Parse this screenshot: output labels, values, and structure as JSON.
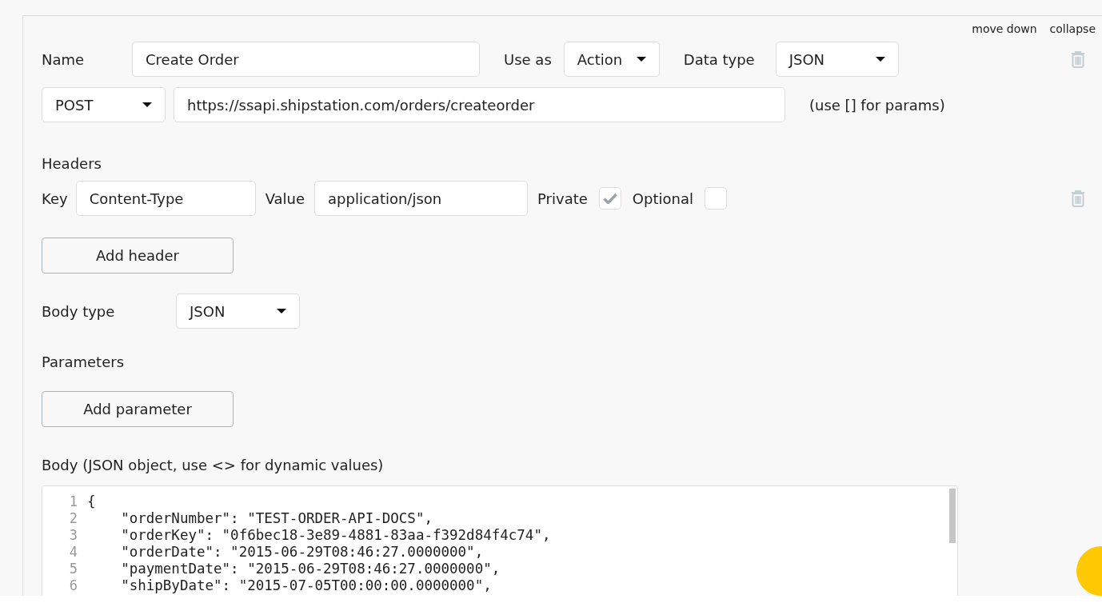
{
  "header_actions": [
    "move down",
    "collapse"
  ],
  "name": {
    "label": "Name",
    "value": "Create Order"
  },
  "use_as": {
    "label": "Use as",
    "value": "Action"
  },
  "data_type": {
    "label": "Data type",
    "value": "JSON"
  },
  "method": {
    "value": "POST"
  },
  "url": {
    "value": "https://ssapi.shipstation.com/orders/createorder",
    "hint": "(use [] for params)"
  },
  "headers": {
    "title": "Headers",
    "add_button": "Add header",
    "rows": [
      {
        "key_label": "Key",
        "key": "Content-Type",
        "value_label": "Value",
        "value": "application/json",
        "private_label": "Private",
        "private": true,
        "optional_label": "Optional",
        "optional": false
      }
    ]
  },
  "body_type": {
    "label": "Body type",
    "value": "JSON"
  },
  "parameters": {
    "title": "Parameters",
    "add_button": "Add parameter"
  },
  "body": {
    "label": "Body (JSON object, use <> for dynamic values)",
    "lines": [
      {
        "number": "1",
        "text": "{"
      },
      {
        "number": "2",
        "text": "    \"orderNumber\": \"TEST-ORDER-API-DOCS\","
      },
      {
        "number": "3",
        "text": "    \"orderKey\": \"0f6bec18-3e89-4881-83aa-f392d84f4c74\","
      },
      {
        "number": "4",
        "text": "    \"orderDate\": \"2015-06-29T08:46:27.0000000\","
      },
      {
        "number": "5",
        "text": "    \"paymentDate\": \"2015-06-29T08:46:27.0000000\","
      },
      {
        "number": "6",
        "text": "    \"shipByDate\": \"2015-07-05T00:00:00.0000000\","
      }
    ]
  }
}
